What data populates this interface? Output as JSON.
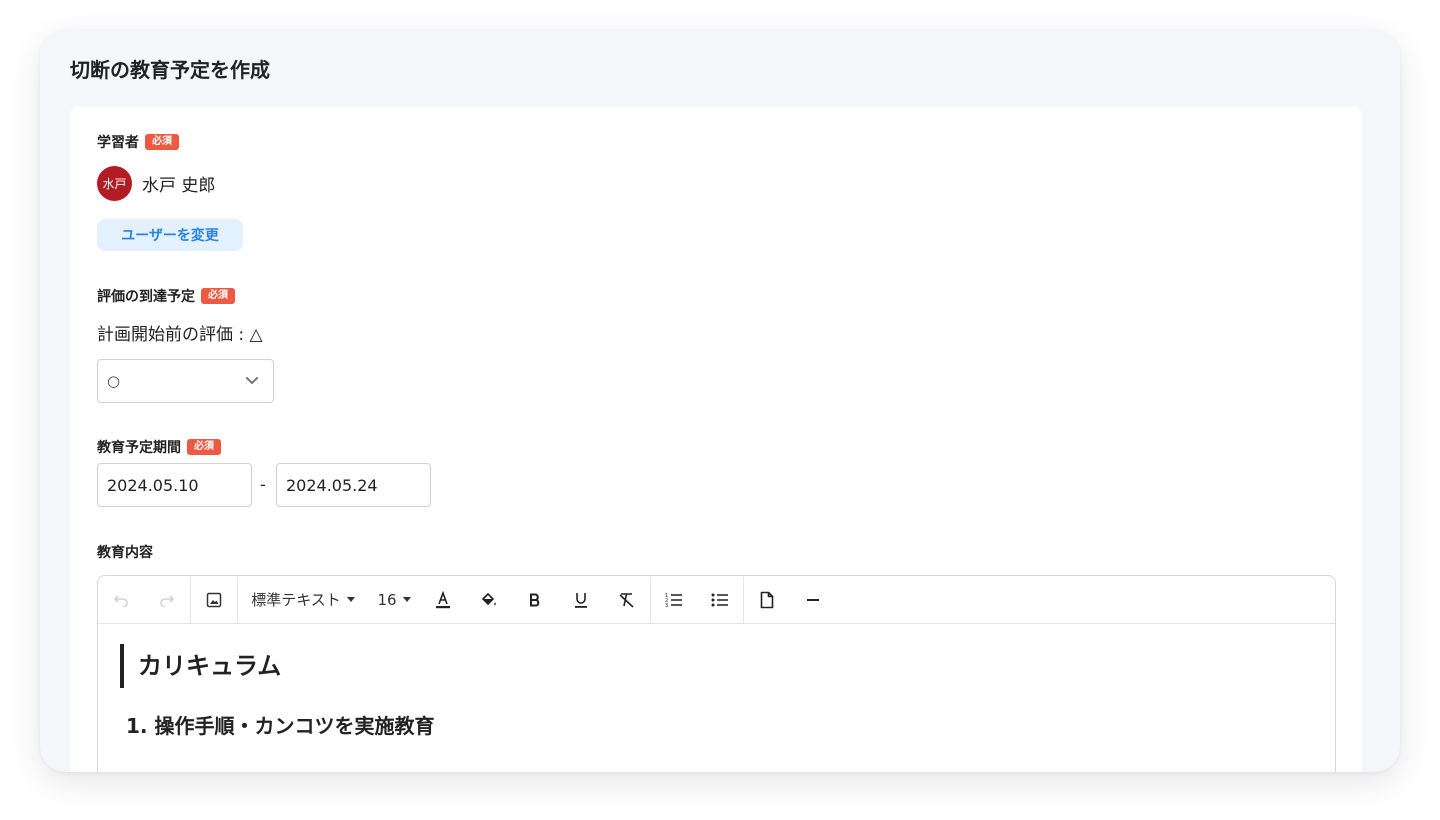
{
  "page": {
    "title": "切断の教育予定を作成"
  },
  "learner": {
    "label": "学習者",
    "required": "必須",
    "avatar_text": "水戸",
    "avatar_color": "#b31c22",
    "name": "水戸 史郎",
    "change_button": "ユーザーを変更"
  },
  "evaluation": {
    "label": "評価の到達予定",
    "required": "必須",
    "pre_eval": "計画開始前の評価 : △",
    "selected": "○"
  },
  "period": {
    "label": "教育予定期間",
    "required": "必須",
    "start": "2024.05.10",
    "separator": "-",
    "end": "2024.05.24"
  },
  "content": {
    "label": "教育内容",
    "toolbar": {
      "text_style": "標準テキスト",
      "font_size": "16",
      "icons": [
        "undo-icon",
        "redo-icon",
        "image-icon",
        "font-color-icon",
        "fill-color-icon",
        "bold-icon",
        "underline-icon",
        "clear-format-icon",
        "ordered-list-icon",
        "unordered-list-icon",
        "template-icon",
        "horizontal-rule-icon"
      ]
    },
    "body": {
      "heading": "カリキュラム",
      "step1": "1. 操作手順・カンコツを実施教育"
    }
  },
  "colors": {
    "badge": "#ee5a41",
    "accent": "#2a84e0",
    "accent_bg": "#e3f0fd"
  }
}
